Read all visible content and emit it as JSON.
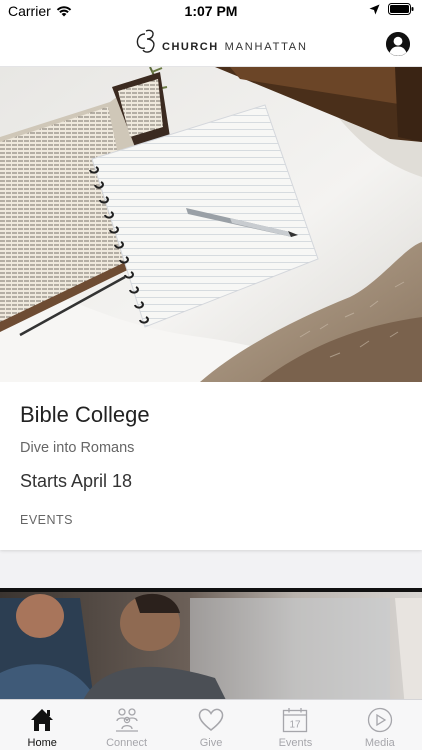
{
  "status_bar": {
    "carrier": "Carrier",
    "time": "1:07 PM"
  },
  "header": {
    "logo_primary": "CHURCH",
    "logo_secondary": "MANHATTAN"
  },
  "feed": {
    "cards": [
      {
        "title": "Bible College",
        "subtitle": "Dive into Romans",
        "date": "Starts April 18",
        "category": "EVENTS"
      }
    ]
  },
  "tab_bar": {
    "active": "Home",
    "tabs": [
      {
        "label": "Home",
        "icon": "home-icon"
      },
      {
        "label": "Connect",
        "icon": "people-icon"
      },
      {
        "label": "Give",
        "icon": "heart-icon"
      },
      {
        "label": "Events",
        "icon": "calendar-icon",
        "badge_day": "17"
      },
      {
        "label": "Media",
        "icon": "play-icon"
      }
    ]
  },
  "colors": {
    "tab_active": "#111111",
    "tab_inactive": "#a6a6ab",
    "background": "#f2f2f4"
  }
}
